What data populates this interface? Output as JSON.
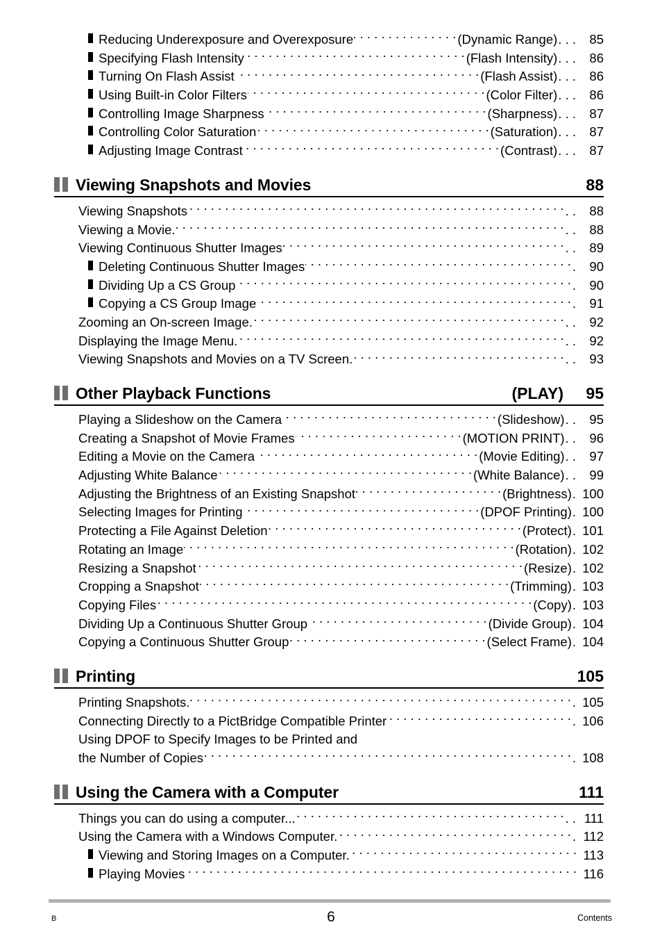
{
  "document": {
    "page_number": "6",
    "footer_left": "B",
    "footer_right": "Contents"
  },
  "top_entries": [
    {
      "title": "Reducing Underexposure and Overexposure",
      "tag": "(Dynamic Range)",
      "tail": ". . .",
      "page": "85",
      "level": 2
    },
    {
      "title": "Specifying Flash Intensity",
      "tag": "(Flash Intensity)",
      "tail": ". . .",
      "page": "86",
      "level": 2
    },
    {
      "title": "Turning On Flash Assist",
      "tag": "(Flash Assist)",
      "tail": ". . .",
      "page": "86",
      "level": 2
    },
    {
      "title": "Using Built-in Color Filters",
      "tag": "(Color Filter)",
      "tail": ". . .",
      "page": "86",
      "level": 2
    },
    {
      "title": "Controlling Image Sharpness",
      "tag": "(Sharpness)",
      "tail": ". . .",
      "page": "87",
      "level": 2
    },
    {
      "title": "Controlling Color Saturation",
      "tag": "(Saturation)",
      "tail": ". . .",
      "page": "87",
      "level": 2
    },
    {
      "title": "Adjusting Image Contrast",
      "tag": "(Contrast)",
      "tail": ". . .",
      "page": "87",
      "level": 2
    }
  ],
  "sections": [
    {
      "heading": "Viewing Snapshots and Movies",
      "heading_tag": "",
      "heading_page": "88",
      "entries": [
        {
          "title": "Viewing Snapshots",
          "tag": "",
          "tail": ". .",
          "page": "88",
          "level": 1
        },
        {
          "title": "Viewing a Movie.",
          "tag": "",
          "tail": ". .",
          "page": "88",
          "level": 1
        },
        {
          "title": "Viewing Continuous Shutter Images",
          "tag": "",
          "tail": ". .",
          "page": "89",
          "level": 1
        },
        {
          "title": "Deleting Continuous Shutter Images",
          "tag": "",
          "tail": ".",
          "page": "90",
          "level": 2
        },
        {
          "title": "Dividing Up a CS Group",
          "tag": "",
          "tail": ".",
          "page": "90",
          "level": 2
        },
        {
          "title": "Copying a CS Group Image",
          "tag": "",
          "tail": ".",
          "page": "91",
          "level": 2
        },
        {
          "title": "Zooming an On-screen Image.",
          "tag": "",
          "tail": ". .",
          "page": "92",
          "level": 1
        },
        {
          "title": "Displaying the Image Menu.",
          "tag": "",
          "tail": ". .",
          "page": "92",
          "level": 1
        },
        {
          "title": "Viewing Snapshots and Movies on a TV Screen.",
          "tag": "",
          "tail": ". .",
          "page": "93",
          "level": 1
        }
      ]
    },
    {
      "heading": "Other Playback Functions",
      "heading_tag": "(PLAY)",
      "heading_page": "95",
      "entries": [
        {
          "title": "Playing a Slideshow on the Camera",
          "tag": "(Slideshow)",
          "tail": ". .",
          "page": "95",
          "level": 1
        },
        {
          "title": "Creating a Snapshot of Movie Frames",
          "tag": "(MOTION PRINT)",
          "tail": ". .",
          "page": "96",
          "level": 1
        },
        {
          "title": "Editing a Movie on the Camera",
          "tag": "(Movie Editing)",
          "tail": ". .",
          "page": "97",
          "level": 1
        },
        {
          "title": "Adjusting White Balance",
          "tag": "(White Balance)",
          "tail": ". .",
          "page": "99",
          "level": 1
        },
        {
          "title": "Adjusting the Brightness of an Existing Snapshot",
          "tag": "(Brightness)",
          "tail": ".",
          "page": "100",
          "level": 1
        },
        {
          "title": "Selecting Images for Printing",
          "tag": "(DPOF Printing)",
          "tail": ".",
          "page": "100",
          "level": 1
        },
        {
          "title": "Protecting a File Against Deletion",
          "tag": "(Protect)",
          "tail": ".",
          "page": "101",
          "level": 1
        },
        {
          "title": "Rotating an Image",
          "tag": "(Rotation)",
          "tail": ".",
          "page": "102",
          "level": 1
        },
        {
          "title": "Resizing a Snapshot",
          "tag": "(Resize)",
          "tail": ".",
          "page": "102",
          "level": 1
        },
        {
          "title": "Cropping a Snapshot",
          "tag": "(Trimming)",
          "tail": ".",
          "page": "103",
          "level": 1
        },
        {
          "title": "Copying Files",
          "tag": "(Copy)",
          "tail": ".",
          "page": "103",
          "level": 1
        },
        {
          "title": "Dividing Up a Continuous Shutter Group",
          "tag": "(Divide Group)",
          "tail": ".",
          "page": "104",
          "level": 1
        },
        {
          "title": "Copying a Continuous Shutter Group",
          "tag": "(Select Frame)",
          "tail": ".",
          "page": "104",
          "level": 1
        }
      ]
    },
    {
      "heading": "Printing",
      "heading_tag": "",
      "heading_page": "105",
      "entries": [
        {
          "title": "Printing Snapshots.",
          "tag": "",
          "tail": ".",
          "page": "105",
          "level": 1
        },
        {
          "title": "Connecting Directly to a PictBridge Compatible Printer",
          "tag": "",
          "tail": ".",
          "page": "106",
          "level": 1
        },
        {
          "title": "Using DPOF to Specify Images to be Printed and",
          "tag": "",
          "tail": "",
          "page": "",
          "level": 1,
          "noleader": true
        },
        {
          "title": "the Number of Copies",
          "tag": "",
          "tail": ".",
          "page": "108",
          "level": 1
        }
      ]
    },
    {
      "heading": "Using the Camera with a Computer",
      "heading_tag": "",
      "heading_page": "111",
      "entries": [
        {
          "title": "Things you can do using a computer...",
          "tag": "",
          "tail": ". .",
          "page": "111",
          "level": 1
        },
        {
          "title": "Using the Camera with a Windows Computer.",
          "tag": "",
          "tail": ".",
          "page": "112",
          "level": 1
        },
        {
          "title": "Viewing and Storing Images on a Computer.",
          "tag": "",
          "tail": "",
          "page": "113",
          "level": 2
        },
        {
          "title": "Playing Movies",
          "tag": "",
          "tail": "",
          "page": "116",
          "level": 2
        }
      ]
    }
  ]
}
